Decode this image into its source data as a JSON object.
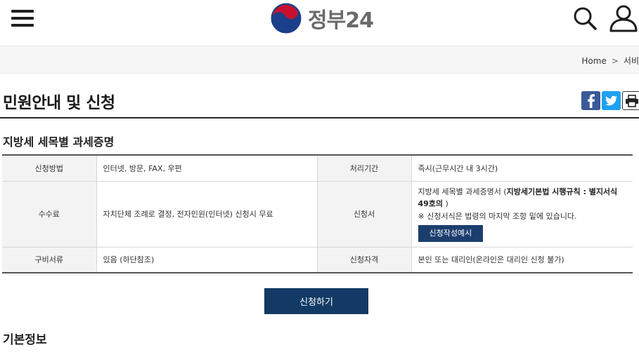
{
  "header": {
    "logo_text": "정부24",
    "logo_colors": {
      "red": "#c8102e",
      "blue": "#1b3f8b"
    }
  },
  "breadcrumb": {
    "home": "Home",
    "separator": ">",
    "current": "서비"
  },
  "page": {
    "title": "민원안내 및 신청",
    "subtitle": "지방세 세목별 과세증명"
  },
  "share": {
    "facebook": "f",
    "print_icon": "printer-icon"
  },
  "info": {
    "method_label": "신청방법",
    "method_value": "인터넷, 방문, FAX, 우편",
    "period_label": "처리기간",
    "period_value": "즉시(근무시간 내 3시간)",
    "fee_label": "수수료",
    "fee_value": "자치단체 조례로 결정, 전자민원(인터넷) 신청시 무료",
    "form_label": "신청서",
    "form_value_prefix": "지방세 세목별 과세증명서 (",
    "form_value_bold": "지방세기본법 시행규칙 : 별지서식 49호의",
    "form_value_suffix": " )",
    "form_note": "※ 신청서식은 법령의 마지막 조항 밑에 있습니다.",
    "form_example_button": "신청작성예시",
    "docs_label": "구비서류",
    "docs_value": "있음 (하단참조)",
    "qual_label": "신청자격",
    "qual_value": "본인 또는 대리인(온라인은 대리인 신청 불가)"
  },
  "actions": {
    "apply_label": "신청하기"
  },
  "sections": {
    "basic_info": "기본정보"
  }
}
